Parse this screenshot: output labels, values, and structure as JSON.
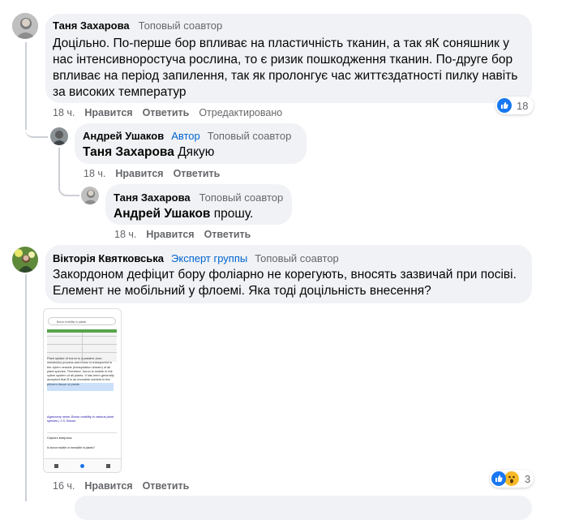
{
  "comments": [
    {
      "author": "Таня Захарова",
      "badges": [
        "Топовый соавтор"
      ],
      "text": "Доцільно. По-перше бор впливає на пластичність тканин, а так яК соняшник у нас інтенсивноростуча рослина, то є ризик пошкодження тканин. По-друге бор впливає на період запилення, так як пролонгує час життєздатності пилку навіть за високих температур",
      "time": "18 ч.",
      "like_label": "Нравится",
      "reply_label": "Ответить",
      "edited_label": "Отредактировано",
      "reaction_count": "18"
    },
    {
      "author": "Андрей Ушаков",
      "badges": [
        "Автор",
        "Топовый соавтор"
      ],
      "mention": "Таня Захарова",
      "text": "Дякую",
      "time": "18 ч.",
      "like_label": "Нравится",
      "reply_label": "Ответить"
    },
    {
      "author": "Таня Захарова",
      "badges": [
        "Топовый соавтор"
      ],
      "mention": "Андрей Ушаков",
      "text": "прошу.",
      "time": "18 ч.",
      "like_label": "Нравится",
      "reply_label": "Ответить"
    },
    {
      "author": "Вікторія Квятковська",
      "badges": [
        "Эксперт группы",
        "Топовый соавтор"
      ],
      "text": "Закордоном дефіцит бору фоліарно не корегують, вносять зазвичай при посіві. Елемент не мобільний у флоемі. Яка тоді доцільність внесення?",
      "time": "16 ч.",
      "like_label": "Нравится",
      "reply_label": "Ответить",
      "reaction_count": "3"
    }
  ],
  "attachment": {
    "search_text": "Boron mobility in plants",
    "body_text": "Plant uptake of boron is a passive (non-metabolic) process and boron is transported in the xylem vessels (transpiration stream) of all plant species. Therefore, boron is mobile in the xylem system of all plants. It has been generally accepted that B is an immobile nutrient in the phloem tissue of plants",
    "link_text": "Agronomy news: Boron mobility in various plant species | J.S. Brown",
    "footer_text": "Скрыть вопросы",
    "question_text": "Is boron mobile or immobile in plants?"
  },
  "colors": {
    "bubble": "#f0f2f5",
    "text": "#050505",
    "meta": "#65676b",
    "accent": "#1877f2",
    "expert": "#0064d1",
    "thread": "#ccd0d5"
  }
}
